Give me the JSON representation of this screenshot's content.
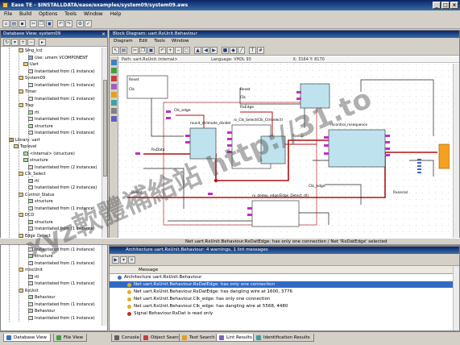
{
  "window": {
    "title": "Ease TE - $INSTALLDATA/ease/examples/system09/system09.aws"
  },
  "menubar": [
    "File",
    "Build",
    "Options",
    "Tools",
    "Window",
    "Help"
  ],
  "database_view": {
    "title": "Database View: system09",
    "tree": [
      {
        "label": "Smg_lcd",
        "indent": 3,
        "icon": "folder"
      },
      {
        "label": "Use: umem VCOMPONENT",
        "indent": 5,
        "icon": "entity"
      },
      {
        "label": "Uart",
        "indent": 4,
        "icon": "folder"
      },
      {
        "label": "Instantiated from (1 instance)",
        "indent": 5,
        "icon": "inst"
      },
      {
        "label": "System09",
        "indent": 3,
        "icon": "folder"
      },
      {
        "label": "Instantiated from (1 instance)",
        "indent": 5,
        "icon": "inst"
      },
      {
        "label": "Timer",
        "indent": 3,
        "icon": "folder"
      },
      {
        "label": "Instantiated from (1 instance)",
        "indent": 5,
        "icon": "inst"
      },
      {
        "label": "Trap",
        "indent": 3,
        "icon": "folder"
      },
      {
        "label": "rtl",
        "indent": 5,
        "icon": "arch"
      },
      {
        "label": "Instantiated from (1 instance)",
        "indent": 5,
        "icon": "inst"
      },
      {
        "label": "structure",
        "indent": 5,
        "icon": "arch"
      },
      {
        "label": "Instantiated from (1 instance)",
        "indent": 5,
        "icon": "inst"
      },
      {
        "label": "Library: uart",
        "indent": 1,
        "icon": "lib"
      },
      {
        "label": "Toplevel",
        "indent": 2,
        "icon": "folder"
      },
      {
        "label": "<Internal> (structure)",
        "indent": 4,
        "icon": "arch"
      },
      {
        "label": "structure",
        "indent": 4,
        "icon": "arch"
      },
      {
        "label": "Instantiated from (2 instances)",
        "indent": 5,
        "icon": "inst"
      },
      {
        "label": "Clk_Select",
        "indent": 3,
        "icon": "folder"
      },
      {
        "label": "rtl",
        "indent": 5,
        "icon": "arch"
      },
      {
        "label": "Instantiated from (2 instances)",
        "indent": 5,
        "icon": "inst"
      },
      {
        "label": "Control_Status",
        "indent": 3,
        "icon": "folder"
      },
      {
        "label": "structure",
        "indent": 5,
        "icon": "arch"
      },
      {
        "label": "Instantiated from (1 instance)",
        "indent": 5,
        "icon": "inst"
      },
      {
        "label": "DCD",
        "indent": 3,
        "icon": "folder"
      },
      {
        "label": "structure",
        "indent": 5,
        "icon": "arch"
      },
      {
        "label": "Instantiated from (1 instance)",
        "indent": 5,
        "icon": "inst"
      },
      {
        "label": "Edge_Detect",
        "indent": 3,
        "icon": "folder"
      },
      {
        "label": "rtl",
        "indent": 5,
        "icon": "arch"
      },
      {
        "label": "Instantiated from (1 instance)",
        "indent": 5,
        "icon": "inst"
      },
      {
        "label": "structure",
        "indent": 5,
        "icon": "arch"
      },
      {
        "label": "Instantiated from (1 instance)",
        "indent": 5,
        "icon": "inst"
      },
      {
        "label": "miscUnit",
        "indent": 3,
        "icon": "folder"
      },
      {
        "label": "rtl",
        "indent": 5,
        "icon": "arch"
      },
      {
        "label": "Instantiated from (1 instance)",
        "indent": 5,
        "icon": "inst"
      },
      {
        "label": "RxUnit",
        "indent": 3,
        "icon": "folder"
      },
      {
        "label": "Behaviour",
        "indent": 5,
        "icon": "arch"
      },
      {
        "label": "Instantiated from (1 instance)",
        "indent": 5,
        "icon": "inst"
      },
      {
        "label": "Behaviour",
        "indent": 5,
        "icon": "arch"
      },
      {
        "label": "Instantiated from (1 instance)",
        "indent": 5,
        "icon": "inst"
      }
    ]
  },
  "block_diagram": {
    "title": "Block Diagram: uart.RxUnit.Behaviour",
    "menu": [
      "Diagram",
      "Edit",
      "Tools",
      "Window"
    ],
    "path": "Path: uart.RxUnit::Internal>",
    "language": "Language: VHDL 93",
    "coords": "X: 3164 Y: 8170",
    "blocks": [
      {
        "name": "",
        "label": "Reset",
        "ports": [
          "Reset",
          "Clk"
        ]
      },
      {
        "name": "rxunit_ctrlmode_divider",
        "label": "rxunit_ctrlmode_divider"
      },
      {
        "name": "rx_ctrl_latch",
        "label": "rx_Clk_Select(Clk_Ctrlselect)"
      },
      {
        "name": "rx_deedge",
        "label": "rx_dedep_edge(Edge_Detect_rtl)"
      },
      {
        "name": "rxcontrol",
        "label": "rxcontrol_rxsequence"
      }
    ],
    "wire_labels": [
      "Clk_edge",
      "RxEdge",
      "RxData",
      "Rxdsp",
      "RxDat",
      "Clk_edge",
      "Reset",
      "Clk",
      "Rxserial"
    ]
  },
  "status_line": "Net uart.RxUnit.Behaviour.RxDatEdge: has only one connection / Net 'RxDatEdge' selected",
  "messages": {
    "title": "Architecture uart.RxUnit.Behaviour: 4 warnings, 1 lint messages",
    "column": "Message",
    "rows": [
      {
        "text": "Architecture uart.RxUnit.Behaviour",
        "type": "info",
        "selected": false
      },
      {
        "text": "Net uart.RxUnit.Behaviour.RxDatEdge: has only one connection",
        "type": "warn",
        "selected": true
      },
      {
        "text": "Net uart.RxUnit.Behaviour.RxDatEdge: has dangling wire at 1600, 3776",
        "type": "warn",
        "selected": false
      },
      {
        "text": "Net uart.RxUnit.Behaviour.Clk_edge: has only one connection",
        "type": "warn",
        "selected": false
      },
      {
        "text": "Net uart.RxUnit.Behaviour.Clk_edge: has dangling wire at 5568, 4480",
        "type": "warn",
        "selected": false
      },
      {
        "text": "Signal Behaviour.RxDat is read only",
        "type": "lint",
        "selected": false
      }
    ]
  },
  "tabs_left": [
    {
      "label": "Database View",
      "active": true
    },
    {
      "label": "File View",
      "active": false
    }
  ],
  "tabs_bottom": [
    {
      "label": "Console",
      "active": false
    },
    {
      "label": "Object Search",
      "active": false
    },
    {
      "label": "Text Search",
      "active": false
    },
    {
      "label": "Lint Results",
      "active": true
    },
    {
      "label": "Identification Results",
      "active": false
    }
  ],
  "watermark": "xyz軟體補給站 http://31.to"
}
